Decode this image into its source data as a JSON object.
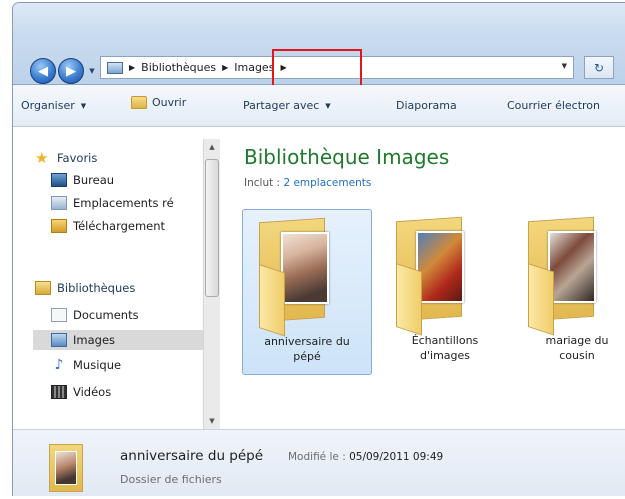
{
  "address_bar": {
    "crumbs": [
      "Bibliothèques",
      "Images"
    ]
  },
  "toolbar": {
    "organize": "Organiser",
    "open": "Ouvrir",
    "share": "Partager avec",
    "slideshow": "Diaporama",
    "email": "Courrier électron"
  },
  "sidebar": {
    "favorites": {
      "label": "Favoris",
      "items": [
        {
          "label": "Bureau",
          "icon": "desktop-icon"
        },
        {
          "label": "Emplacements ré",
          "icon": "recent-places-icon"
        },
        {
          "label": "Téléchargement",
          "icon": "downloads-icon"
        }
      ]
    },
    "libraries": {
      "label": "Bibliothèques",
      "items": [
        {
          "label": "Documents",
          "icon": "documents-icon"
        },
        {
          "label": "Images",
          "icon": "pictures-icon",
          "selected": true
        },
        {
          "label": "Musique",
          "icon": "music-icon"
        },
        {
          "label": "Vidéos",
          "icon": "videos-icon"
        }
      ]
    }
  },
  "library": {
    "title": "Bibliothèque Images",
    "includes_label": "Inclut :",
    "includes_link": "2 emplacements"
  },
  "folders": [
    {
      "line1": "anniversaire du",
      "line2": "pépé",
      "selected": true
    },
    {
      "line1": "Échantillons",
      "line2": "d'images",
      "selected": false
    },
    {
      "line1": "mariage du",
      "line2": "cousin",
      "selected": false
    }
  ],
  "details": {
    "name": "anniversaire du pépé",
    "modified_label": "Modifié le :",
    "modified_value": "05/09/2011 09:49",
    "type": "Dossier de fichiers"
  },
  "colors": {
    "library_title": "#1f7a2c",
    "highlight_box": "#e4161b",
    "link": "#1f6fc5"
  }
}
